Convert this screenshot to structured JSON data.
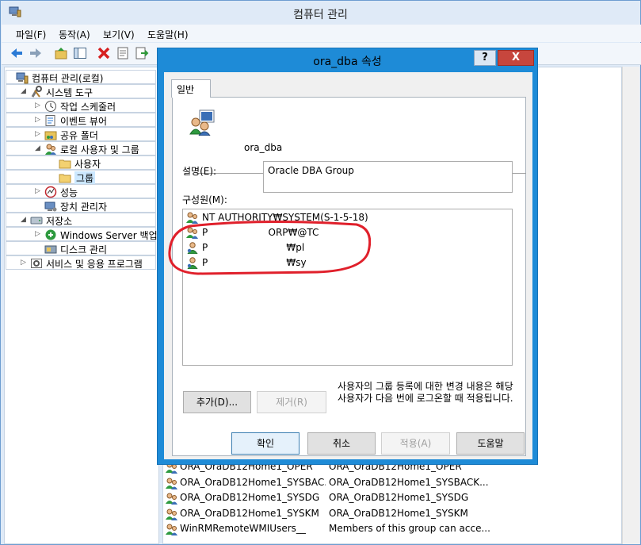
{
  "window": {
    "title": "컴퓨터 관리"
  },
  "menu": [
    "파일(F)",
    "동작(A)",
    "보기(V)",
    "도움말(H)"
  ],
  "toolbar": [
    "back-icon",
    "forward-icon",
    "up-icon",
    "show-tree-icon",
    "delete-icon",
    "properties-icon",
    "export-icon"
  ],
  "tree": [
    {
      "label": "컴퓨터 관리(로컬)",
      "icon": "computer-management-icon",
      "twisty": "",
      "level": 0
    },
    {
      "label": "시스템 도구",
      "icon": "system-tools-icon",
      "twisty": "◢",
      "level": 1
    },
    {
      "label": "작업 스케줄러",
      "icon": "task-scheduler-icon",
      "twisty": "▷",
      "level": 2
    },
    {
      "label": "이벤트 뷰어",
      "icon": "event-viewer-icon",
      "twisty": "▷",
      "level": 2
    },
    {
      "label": "공유 폴더",
      "icon": "shared-folder-icon",
      "twisty": "▷",
      "level": 2
    },
    {
      "label": "로컬 사용자 및 그룹",
      "icon": "local-users-icon",
      "twisty": "◢",
      "level": 2
    },
    {
      "label": "사용자",
      "icon": "folder-icon",
      "twisty": "",
      "level": 3
    },
    {
      "label": "그룹",
      "icon": "folder-icon",
      "twisty": "",
      "level": 3,
      "selected": true
    },
    {
      "label": "성능",
      "icon": "performance-icon",
      "twisty": "▷",
      "level": 2
    },
    {
      "label": "장치 관리자",
      "icon": "device-manager-icon",
      "twisty": "",
      "level": 2
    },
    {
      "label": "저장소",
      "icon": "storage-icon",
      "twisty": "◢",
      "level": 1
    },
    {
      "label": "Windows Server 백업",
      "icon": "backup-icon",
      "twisty": "▷",
      "level": 2
    },
    {
      "label": "디스크 관리",
      "icon": "disk-management-icon",
      "twisty": "",
      "level": 2
    },
    {
      "label": "서비스 및 응용 프로그램",
      "icon": "services-icon",
      "twisty": "▷",
      "level": 1
    }
  ],
  "groups": [
    {
      "name": "ORA_OraDB12Home1_OPER",
      "description": "ORA_OraDB12Home1_OPER"
    },
    {
      "name": "ORA_OraDB12Home1_SYSBAC...",
      "description": "ORA_OraDB12Home1_SYSBACK..."
    },
    {
      "name": "ORA_OraDB12Home1_SYSDG",
      "description": "ORA_OraDB12Home1_SYSDG"
    },
    {
      "name": "ORA_OraDB12Home1_SYSKM",
      "description": "ORA_OraDB12Home1_SYSKM"
    },
    {
      "name": "WinRMRemoteWMIUsers__",
      "description": "Members of this group can acce..."
    }
  ],
  "dialog": {
    "title": "ora_dba 속성",
    "help": "?",
    "close": "X",
    "tab": "일반",
    "group_name": "ora_dba",
    "description_label": "설명(E):",
    "description_value": "Oracle DBA Group",
    "members_label": "구성원(M):",
    "members": [
      {
        "text": "NT AUTHORITY₩SYSTEM(S-1-5-18)",
        "icon": "user-group-icon"
      },
      {
        "text": "P                    ORP₩@TC",
        "icon": "user-group-icon"
      },
      {
        "text": "P                          ₩pl",
        "icon": "user-icon"
      },
      {
        "text": "P                          ₩sy",
        "icon": "user-icon"
      }
    ],
    "add_button": "추가(D)...",
    "remove_button": "제거(R)",
    "note": "사용자의 그룹 등록에 대한 변경 내용은 해당 사용자가 다음 번에 로그온할 때 적용됩니다.",
    "ok_button": "확인",
    "cancel_button": "취소",
    "apply_button": "적용(A)",
    "help_button": "도움말"
  },
  "colors": {
    "accent": "#1e8bd7",
    "annotation": "#e0202b"
  }
}
